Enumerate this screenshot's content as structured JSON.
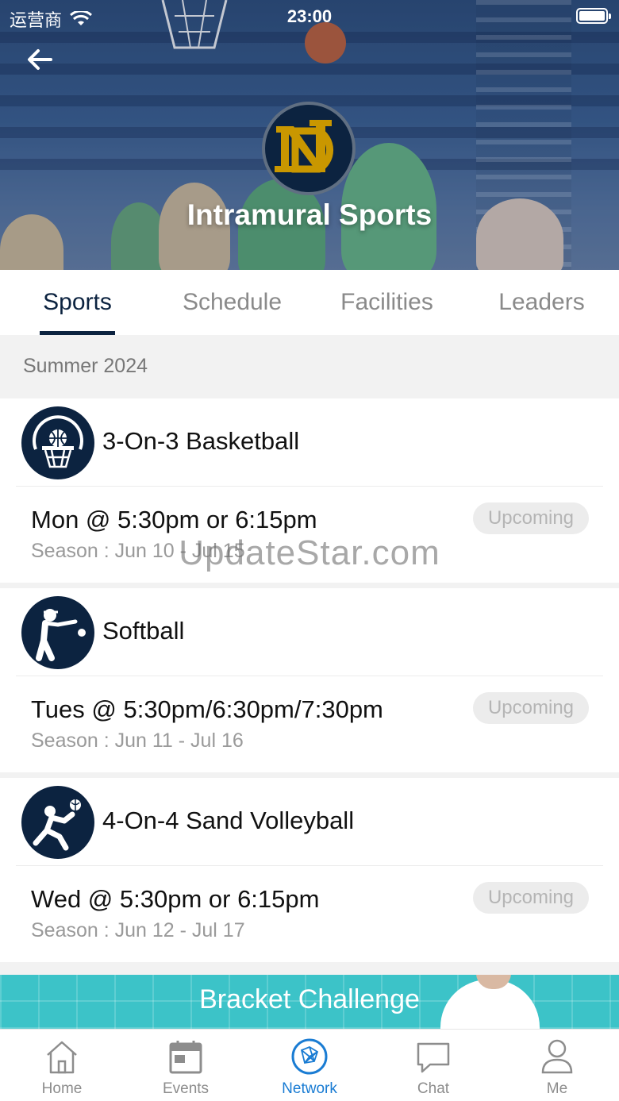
{
  "status_bar": {
    "carrier": "运营商",
    "time": "23:00"
  },
  "header": {
    "title": "Intramural Sports"
  },
  "tabs": [
    {
      "label": "Sports",
      "active": true
    },
    {
      "label": "Schedule",
      "active": false
    },
    {
      "label": "Facilities",
      "active": false
    },
    {
      "label": "Leaders",
      "active": false
    }
  ],
  "section": {
    "title": "Summer 2024"
  },
  "sports": [
    {
      "name": "3-On-3 Basketball",
      "icon": "basketball-hoop-icon",
      "time": "Mon @ 5:30pm or 6:15pm",
      "season": "Season : Jun 10 - Jul 15",
      "status": "Upcoming"
    },
    {
      "name": "Softball",
      "icon": "softball-batter-icon",
      "time": "Tues @ 5:30pm/6:30pm/7:30pm",
      "season": "Season : Jun 11 - Jul 16",
      "status": "Upcoming"
    },
    {
      "name": "4-On-4 Sand Volleyball",
      "icon": "volleyball-player-icon",
      "time": "Wed @ 5:30pm or 6:15pm",
      "season": "Season : Jun 12 - Jul 17",
      "status": "Upcoming"
    }
  ],
  "watermark": "UpdateStar.com",
  "banner": {
    "label": "Bracket Challenge"
  },
  "bottom_nav": [
    {
      "label": "Home",
      "icon": "home-icon",
      "active": false
    },
    {
      "label": "Events",
      "icon": "calendar-icon",
      "active": false
    },
    {
      "label": "Network",
      "icon": "network-icon",
      "active": true
    },
    {
      "label": "Chat",
      "icon": "chat-icon",
      "active": false
    },
    {
      "label": "Me",
      "icon": "person-icon",
      "active": false
    }
  ],
  "colors": {
    "navy": "#0c2340",
    "accent_blue": "#1a7cd3",
    "teal": "#3cc3c8",
    "gold": "#c99700"
  }
}
